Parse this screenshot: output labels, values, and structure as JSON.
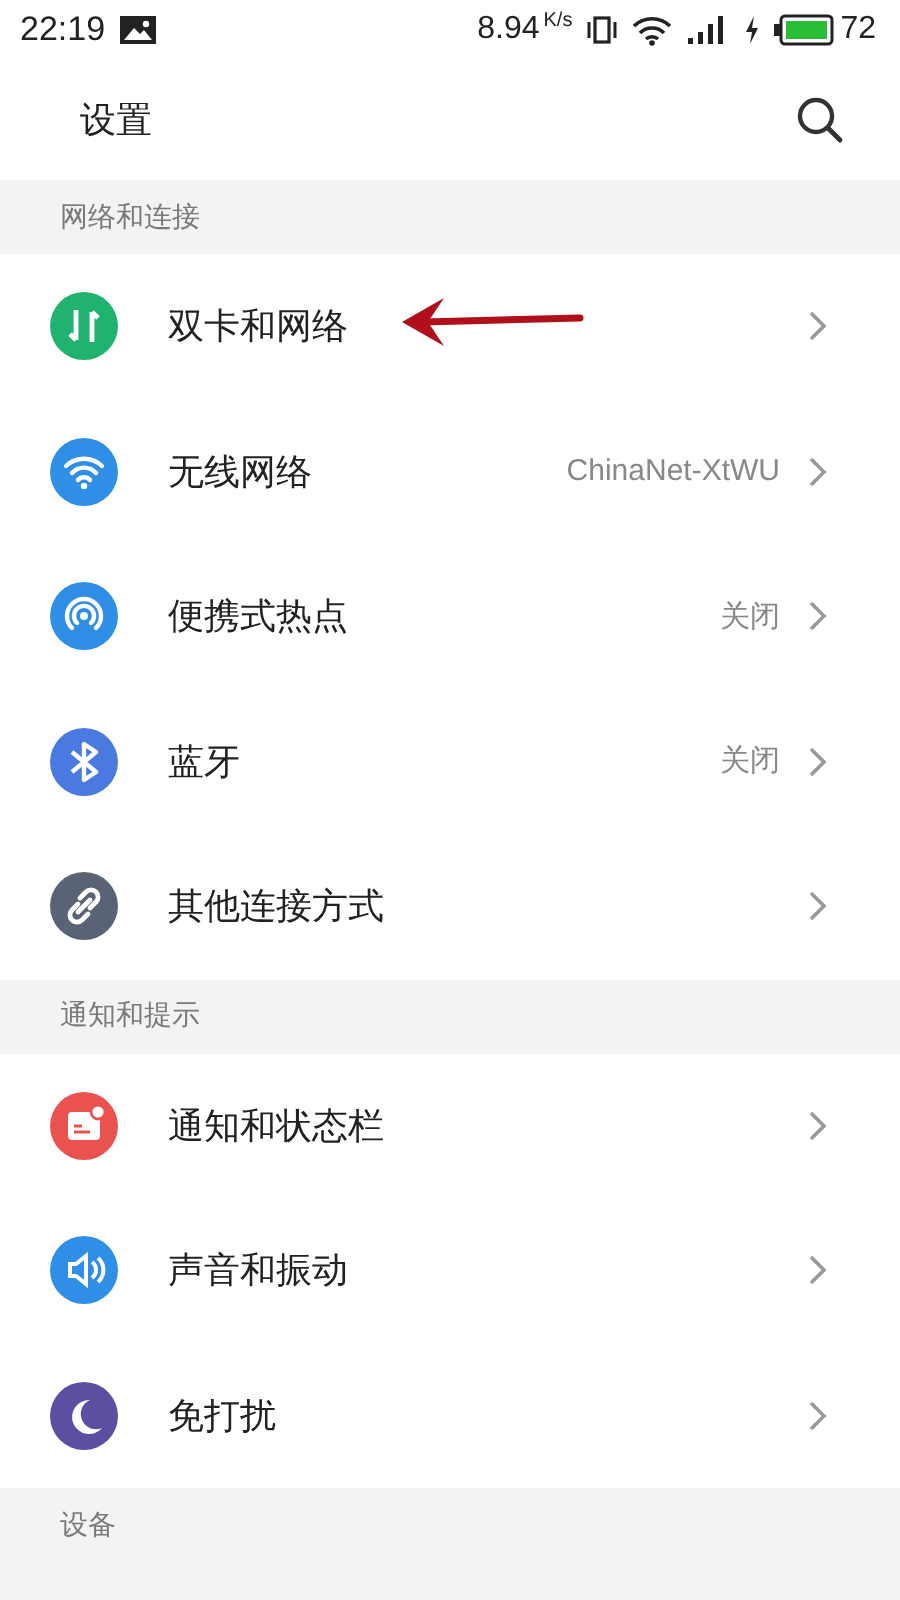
{
  "status_bar": {
    "time": "22:19",
    "speed": "8.94",
    "speed_unit": "K/s",
    "battery": "72"
  },
  "header": {
    "title": "设置"
  },
  "sections": [
    {
      "title": "网络和连接",
      "items": [
        {
          "label": "双卡和网络",
          "color": "#1fb36f"
        },
        {
          "label": "无线网络",
          "value": "ChinaNet-XtWU",
          "color": "#2f8fe6"
        },
        {
          "label": "便携式热点",
          "value": "关闭",
          "color": "#2f8fe6"
        },
        {
          "label": "蓝牙",
          "value": "关闭",
          "color": "#4a7ae0"
        },
        {
          "label": "其他连接方式",
          "color": "#5a6275"
        }
      ]
    },
    {
      "title": "通知和提示",
      "items": [
        {
          "label": "通知和状态栏",
          "color": "#e9524f"
        },
        {
          "label": "声音和振动",
          "color": "#2f8fe6"
        },
        {
          "label": "免打扰",
          "color": "#5a4fa0"
        }
      ]
    },
    {
      "title": "设备"
    }
  ]
}
